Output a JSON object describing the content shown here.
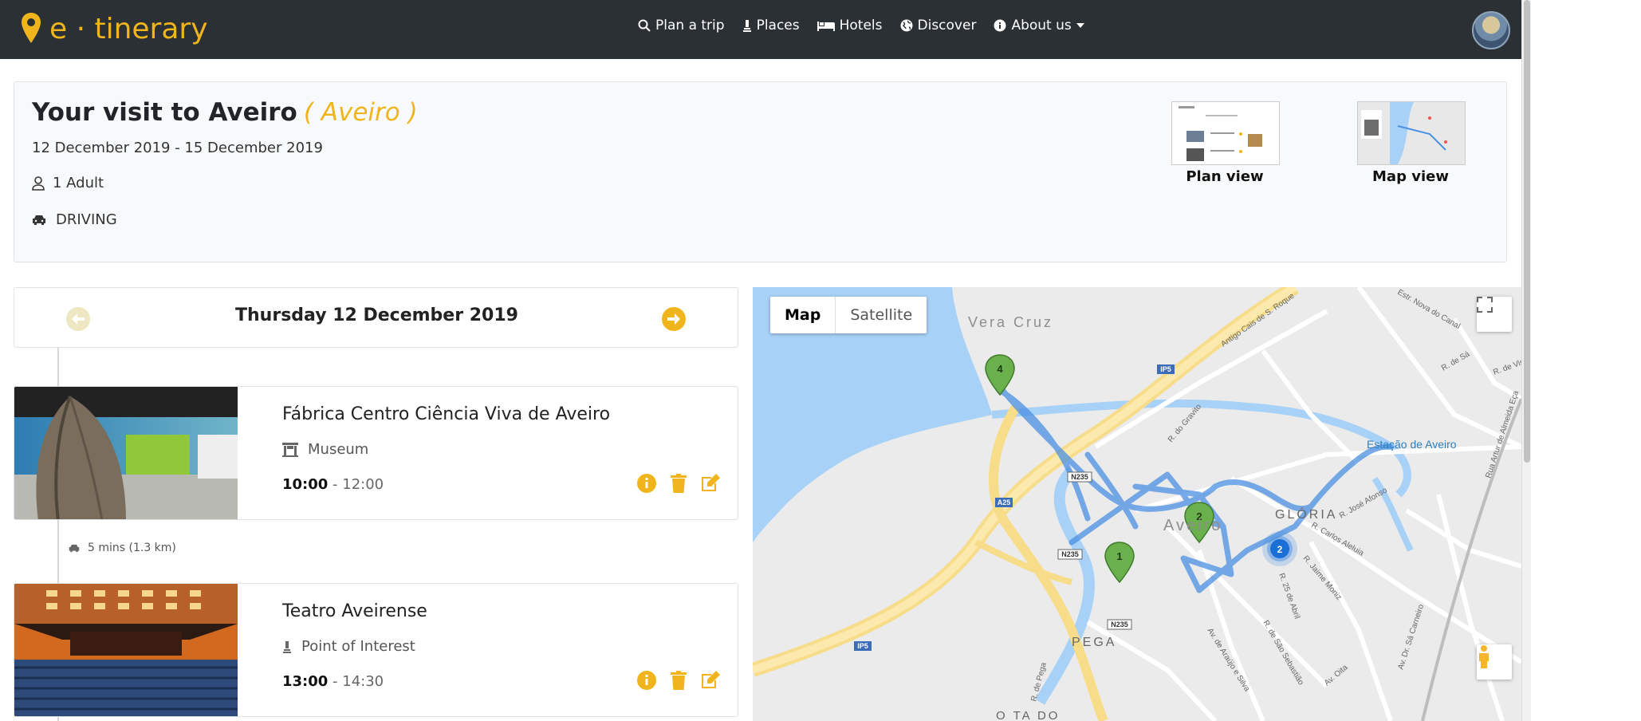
{
  "nav": {
    "brand": "e · tinerary",
    "links": [
      {
        "label": "Plan a trip",
        "icon": "search-icon"
      },
      {
        "label": "Places",
        "icon": "monument-icon"
      },
      {
        "label": "Hotels",
        "icon": "bed-icon"
      },
      {
        "label": "Discover",
        "icon": "globe-icon"
      },
      {
        "label": "About us",
        "icon": "info-icon"
      }
    ]
  },
  "trip": {
    "title": "Your visit to Aveiro",
    "subtitle": "( Aveiro )",
    "dates": "12 December 2019 - 15 December 2019",
    "travellers": "1 Adult",
    "mode": "DRIVING",
    "views": [
      {
        "label": "Plan view"
      },
      {
        "label": "Map view"
      }
    ]
  },
  "day": {
    "title": "Thursday 12 December 2019"
  },
  "items": [
    {
      "name": "Fábrica Centro Ciência Viva de Aveiro",
      "type": "Museum",
      "start": "10:00",
      "end": "12:00"
    },
    {
      "name": "Teatro Aveirense",
      "type": "Point of Interest",
      "start": "13:00",
      "end": "14:30"
    }
  ],
  "travel": {
    "text": "5 mins (1.3 km)"
  },
  "map": {
    "map_label": "Map",
    "satellite_label": "Satellite",
    "areas": [
      "Vera Cruz",
      "Aveiro",
      "GLÓRIA",
      "PEGA",
      "O TA DO"
    ],
    "station": "Estação de Aveiro",
    "roads": [
      "IP5",
      "A25",
      "N235",
      "N235",
      "N235",
      "IP5"
    ],
    "streets": [
      "Estr. Nova do Canal",
      "R. de Sá",
      "R. de Vis",
      "Rua Artur de Almeida Eça",
      "R. José Afonso",
      "R. Carlos Aleluia",
      "R. Jaime Moniz",
      "R. 25 de Abril",
      "R. de São Sebastião",
      "Av. de Araújo e Silva",
      "Av. Dr. Sá Carneiro",
      "R. do Gravito",
      "Antigo Cais de S. Roque",
      "R. de Pega",
      "Av. Oita"
    ],
    "markers": [
      "1",
      "2",
      "2",
      "4"
    ]
  },
  "colors": {
    "accent": "#f0b51c",
    "navbar": "#2b3035",
    "route": "#4a90e2",
    "marker_green": "#6ab04c",
    "water": "#a8d1f7"
  }
}
